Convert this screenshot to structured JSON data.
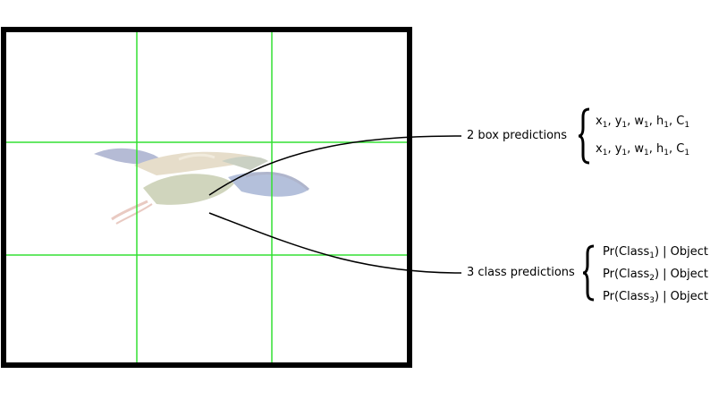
{
  "box_predictions": {
    "label": "2 box predictions",
    "rows": [
      {
        "x": "x",
        "y": "y",
        "w": "w",
        "h": "h",
        "c": "C",
        "sub": "1"
      },
      {
        "x": "x",
        "y": "y",
        "w": "w",
        "h": "h",
        "c": "C",
        "sub": "1"
      }
    ]
  },
  "class_predictions": {
    "label": "3 class predictions",
    "rows": [
      {
        "prefix": "Pr(Class",
        "sub": "1",
        "suffix": ") | Object"
      },
      {
        "prefix": "Pr(Class",
        "sub": "2",
        "suffix": ") | Object"
      },
      {
        "prefix": "Pr(Class",
        "sub": "3",
        "suffix": ") | Object"
      }
    ]
  },
  "colors": {
    "grid_line": "#33e033",
    "frame": "#000000",
    "connector": "#000000"
  },
  "image": {
    "subject_icon": "flying-bird-icon"
  }
}
